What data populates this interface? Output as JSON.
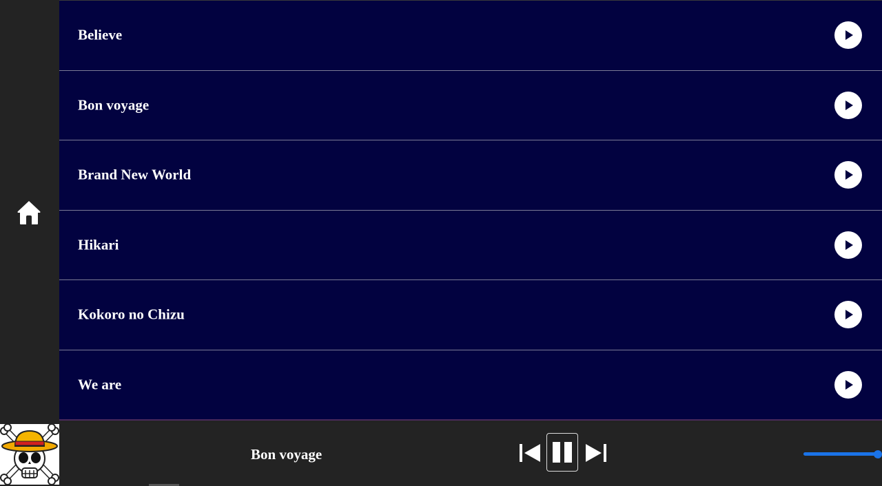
{
  "sidebar": {
    "home_icon": "home-icon"
  },
  "songs": [
    {
      "title": "Believe"
    },
    {
      "title": "Bon voyage"
    },
    {
      "title": "Brand New World"
    },
    {
      "title": "Hikari"
    },
    {
      "title": "Kokoro no Chizu"
    },
    {
      "title": "We are"
    }
  ],
  "player": {
    "now_playing": "Bon voyage",
    "album_art_icon": "straw-hat-jolly-roger-logo",
    "state": "playing",
    "volume": 1.0
  },
  "colors": {
    "list_background": "#020240",
    "panel_background": "#232323",
    "accent": "#1a73e8"
  }
}
